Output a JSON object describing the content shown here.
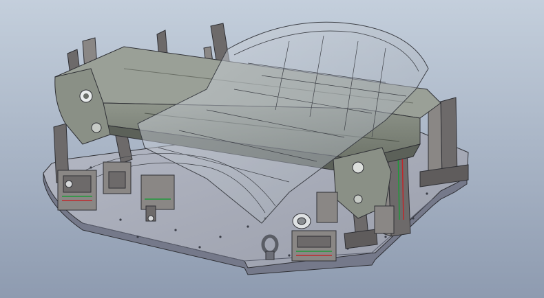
{
  "scene": {
    "subject": "",
    "colors": {
      "background_top": "#c4cfdc",
      "background_bottom": "#8e9bb0",
      "plate_top": "#a9adb9",
      "plate_side": "#75798a",
      "plate_shadow": "#4c5060",
      "fixture_dark": "#6d6a6a",
      "fixture_mid": "#8a8785",
      "boom_body": "#7f857b",
      "boom_light": "#9aa097",
      "boom_shadow": "#5c6159",
      "transparent_fill": "#b6bdc7",
      "edge": "#2e2f34",
      "green_accent": "#1e9a3a",
      "red_accent": "#c0282c"
    }
  }
}
